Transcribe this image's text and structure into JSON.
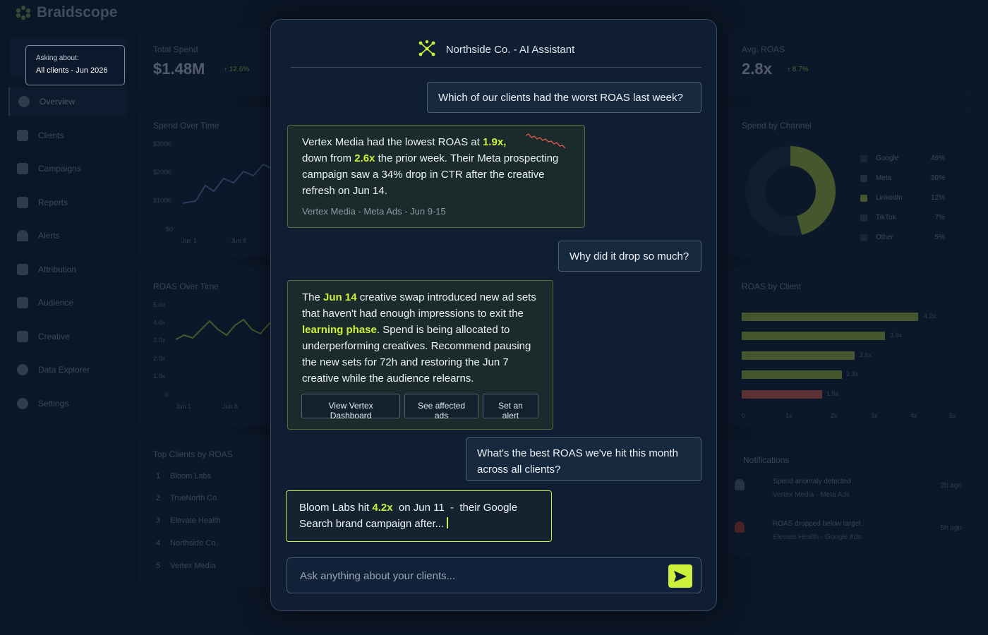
{
  "app": {
    "name": "Braidscope"
  },
  "tooltip": {
    "label": "Asking about:",
    "value": "All clients - Jun 2026"
  },
  "sidebar": {
    "items": [
      {
        "label": "Overview",
        "icon": "clock-icon"
      },
      {
        "label": "Clients",
        "icon": "users-icon"
      },
      {
        "label": "Campaigns",
        "icon": "megaphone-icon"
      },
      {
        "label": "Reports",
        "icon": "document-icon"
      },
      {
        "label": "Alerts",
        "icon": "bell-icon"
      },
      {
        "label": "Attribution",
        "icon": "network-icon"
      },
      {
        "label": "Audience",
        "icon": "group-icon"
      },
      {
        "label": "Creative",
        "icon": "image-icon"
      },
      {
        "label": "Data Explorer",
        "icon": "magnifier-icon"
      },
      {
        "label": "Settings",
        "icon": "gear-icon"
      }
    ]
  },
  "kpis": {
    "total_spend": {
      "title": "Total Spend",
      "value": "$1.48M",
      "delta": "12.6%"
    },
    "avg_roas": {
      "title": "Avg. ROAS",
      "value": "2.8x",
      "delta": "8.7%"
    }
  },
  "spend_over_time": {
    "title": "Spend Over Time",
    "y_ticks": [
      "$300K",
      "$200K",
      "$100K",
      "$0"
    ],
    "x_ticks": [
      "Jun 1",
      "Jun 8"
    ]
  },
  "roas_over_time": {
    "title": "ROAS Over Time",
    "y_ticks": [
      "5.0x",
      "4.0x",
      "3.0x",
      "2.0x",
      "1.0x",
      "0"
    ],
    "x_ticks": [
      "Jun 1",
      "Jun 8"
    ]
  },
  "spend_by_channel": {
    "title": "Spend by Channel",
    "items": [
      {
        "label": "Google",
        "value": "46%",
        "color": "#2d3d55"
      },
      {
        "label": "Meta",
        "value": "30%",
        "color": "#4b5a70"
      },
      {
        "label": "LinkedIn",
        "value": "12%",
        "color": "#a5c53a"
      },
      {
        "label": "TikTok",
        "value": "7%",
        "color": "#3a485c"
      },
      {
        "label": "Other",
        "value": "5%",
        "color": "#34404f"
      }
    ]
  },
  "roas_by_client": {
    "title": "ROAS by Client",
    "values": [
      "4.2x",
      "3.3x",
      "2.6x",
      "2.3x",
      "1.9x"
    ],
    "x_ticks": [
      "0",
      "1x",
      "2x",
      "3x",
      "4x",
      "5x"
    ],
    "colors": [
      "#a5c53a",
      "#a5c53a",
      "#a5c53a",
      "#a5c53a",
      "#e25b4a"
    ]
  },
  "top_clients": {
    "title": "Top Clients by ROAS",
    "rows": [
      {
        "rank": "1",
        "name": "Bloom Labs"
      },
      {
        "rank": "2",
        "name": "TrueNorth Co."
      },
      {
        "rank": "3",
        "name": "Elevate Health"
      },
      {
        "rank": "4",
        "name": "Northside Co."
      },
      {
        "rank": "5",
        "name": "Vertex Media"
      }
    ]
  },
  "notifications": {
    "title": "Notifications",
    "items": [
      {
        "title": "Spend anomaly detected",
        "sub": "Vertex Media - Meta Ads",
        "ago": "2h ago"
      },
      {
        "title": "ROAS dropped below target",
        "sub": "Elevate Health - Google Ads",
        "ago": "5h ago"
      }
    ]
  },
  "chat": {
    "title": "Northside Co. - AI Assistant",
    "messages": {
      "q1": "Which of our clients had the worst ROAS last week?",
      "a1": {
        "p1": "Vertex Media had the lowest ROAS at ",
        "h1": "1.9x,",
        "p2": "down from ",
        "h2": "2.6x",
        "p3": " the prior week. Their Meta prospecting campaign saw a 34% drop in CTR after the creative refresh on Jun 14.",
        "source": "Vertex Media - Meta Ads - Jun 9-15"
      },
      "q2": "Why did it drop so much?",
      "a2": {
        "p1": "The ",
        "h1": "Jun 14",
        "p2": " creative swap introduced new ad sets that haven't had enough impressions to exit the ",
        "h2": "learning phase",
        "p3": ". Spend is being allocated to underperforming creatives. Recommend pausing the new sets for 72h and restoring the Jun 7 creative while the audience relearns.",
        "actions": [
          "View Vertex Dashboard",
          "See affected ads",
          "Set an alert"
        ]
      },
      "q3": "What's the best ROAS we've hit this month across all clients?",
      "a3": {
        "p1": "Bloom Labs hit ",
        "h1": "4.2x",
        "p2": "  on Jun 11  -  their Google Search brand campaign after..."
      }
    },
    "input": {
      "placeholder": "Ask anything about your clients...",
      "value": ""
    }
  }
}
